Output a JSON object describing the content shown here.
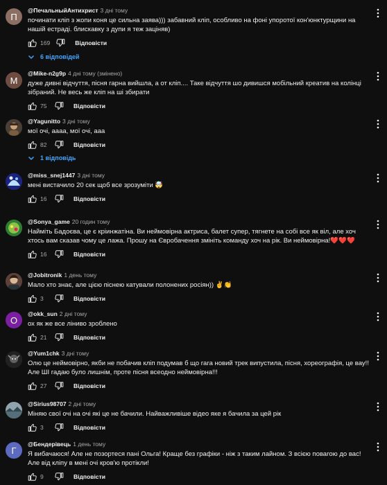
{
  "ui": {
    "reply_label": "Відповісти",
    "icons": {
      "like": "thumbs-up-icon",
      "dislike": "thumbs-down-icon",
      "more": "more-vert-icon",
      "chevron": "chevron-down-icon"
    }
  },
  "comments": [
    {
      "author": "@ПечальныйАнтихрист",
      "time": "3 дні тому",
      "avatar_letter": "П",
      "avatar_color": "#8d6e63",
      "text": "починати кліп з жопи коня це сильна заява))) забавний кліп, особливо на фоні упоротої кон'юнктурщини на нашій естраді. блискавку з дупи я теж заціняв)",
      "likes": "169",
      "replies_label": "6 відповідей"
    },
    {
      "author": "@Mike-n2g9p",
      "time": "4 дні тому (змінено)",
      "avatar_letter": "M",
      "avatar_color": "#6d4c41",
      "text": "дуже дивні відчуття, пісня гарна вийшла, а от кліп.... Таке відчуття шо дивишся мобільний креатив на колінці зібраний. Не весь же кліп на ші збирати",
      "likes": "75",
      "replies_label": ""
    },
    {
      "author": "@Yagunitto",
      "time": "3 дні тому",
      "avatar_letter": "",
      "avatar_color": "#5d4037",
      "text": "мої очі, аааа, мої очі, ааа",
      "likes": "82",
      "replies_label": "1 відповідь"
    },
    {
      "author": "@miss_snej1447",
      "time": "3 дні тому",
      "avatar_letter": "",
      "avatar_color": "#1a237e",
      "text": "мені вистачило 20 сек щоб все зрозуміти 🤯",
      "likes": "16",
      "replies_label": ""
    },
    {
      "author": "@Sonya_game",
      "time": "20 годин тому",
      "avatar_letter": "",
      "avatar_color": "#33691e",
      "text": "Найміть Бадоєва, це є кріинжатіна. Ви неймовірна актриса, балет супер, тягнете на собі все як віл, але хоч хтось вам сказав чому це лажа. Прошу на Євробачення змініть команду хоч на рік. Ви неймовірна!❤️❤️❤️",
      "likes": "16",
      "replies_label": ""
    },
    {
      "author": "@Jobitronik",
      "time": "1 день тому",
      "avatar_letter": "",
      "avatar_color": "#4e342e",
      "text": "Мало хто знає, але цією піснею катували полонених росіян)) ✌️👏",
      "likes": "3",
      "replies_label": ""
    },
    {
      "author": "@okk_sun",
      "time": "2 дні тому",
      "avatar_letter": "O",
      "avatar_color": "#7b1fa2",
      "text": "ох як же все ліниво зроблено",
      "likes": "21",
      "replies_label": ""
    },
    {
      "author": "@Yum1chk",
      "time": "3 дні тому",
      "avatar_letter": "",
      "avatar_color": "#212121",
      "text": "Олю це неймовірно, якби не побачив кліп подумав б що гага новий трек випустила, пісня, хореографія, це вау!! Але ШІ гадаю було лишнім, проте пісня всеодно неймовірна!!!",
      "likes": "27",
      "replies_label": ""
    },
    {
      "author": "@Sirius98707",
      "time": "2 дні тому",
      "avatar_letter": "",
      "avatar_color": "#546e7a",
      "text": "Міняю свої очі на очі які це не бачили. Найважливіше відео яке я бачила за цей рік",
      "likes": "3",
      "replies_label": ""
    },
    {
      "author": "@Бендерівець",
      "time": "1 день тому",
      "avatar_letter": "Г",
      "avatar_color": "#5c6bc0",
      "text": "Я вибачаюся! Але не позортеся пані Ольга! Краще без графіки - ніж з таким лайном. З всією повагою до вас! Але від кліпу в мені очі кров'ю протікли!",
      "likes": "9",
      "replies_label": ""
    }
  ]
}
